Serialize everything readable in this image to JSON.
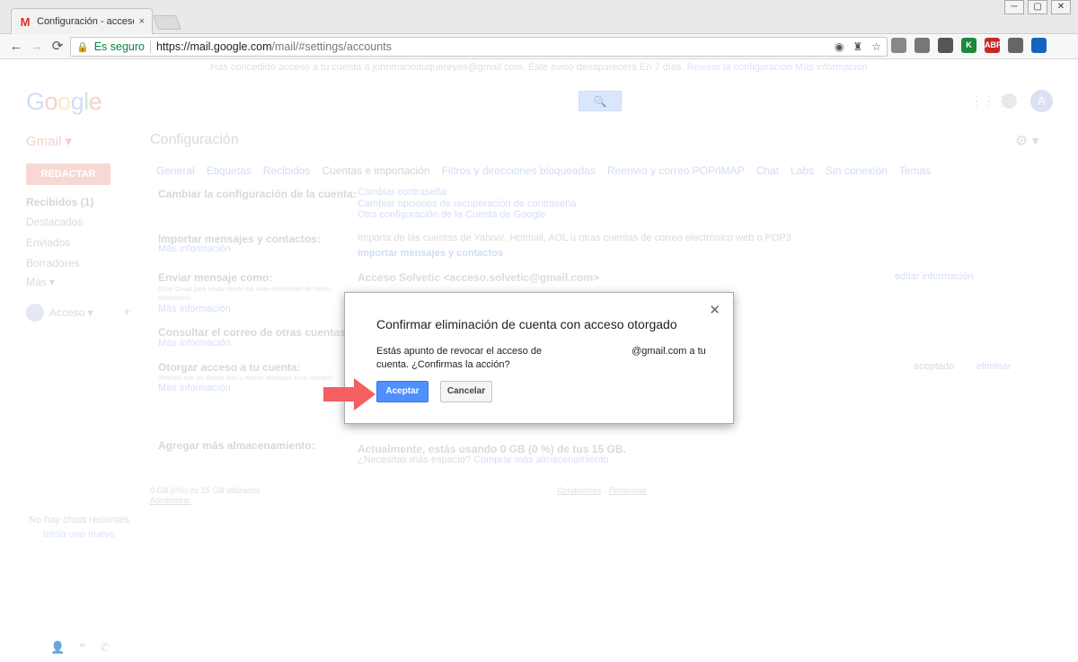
{
  "browser": {
    "tab_title": "Configuración - acceso.solvetic",
    "tab_favicon": "M",
    "tab_close": "×",
    "secure_label": "Es seguro",
    "url_host": "https://mail.google.com",
    "url_path": "/mail/#settings/accounts",
    "back": "←",
    "forward": "→",
    "reload": "⟳",
    "lock": "🔒",
    "win_min": "─",
    "win_max": "▢",
    "win_close": "✕",
    "omni_icons": [
      "◉",
      "♜",
      "☆"
    ],
    "extensions": [
      {
        "label": "",
        "color": "#888888"
      },
      {
        "label": "",
        "color": "#777777"
      },
      {
        "label": "",
        "color": "#555555"
      },
      {
        "label": "K",
        "color": "#1b8a3a"
      },
      {
        "label": "ABP",
        "color": "#c62828"
      },
      {
        "label": "",
        "color": "#666666"
      },
      {
        "label": "",
        "color": "#1565c0"
      }
    ]
  },
  "notice": {
    "text": "Has concedido acceso a tu cuenta a johnmarioduquereyes@gmail.com. Este aviso desaparecerá En 7 días.",
    "review_link": "Revisar la configuración",
    "more_link": "Más información"
  },
  "header": {
    "logo_letters": [
      "G",
      "o",
      "o",
      "g",
      "l",
      "e"
    ],
    "search_icon": "🔍",
    "apps_icon": "⋮⋮⋮",
    "avatar_letter": "A"
  },
  "gmail_label": "Gmail ▾",
  "page_title": "Configuración",
  "gear": "⚙ ▾",
  "sidebar": {
    "compose": "REDACTAR",
    "items": [
      "Recibidos (1)",
      "Destacados",
      "Enviados",
      "Borradores",
      "Más ▾"
    ],
    "account": "Acceso ▾",
    "plus": "+",
    "no_chats": "No hay chats recientes",
    "start_new": "Inicia uno nuevo",
    "bottom_icons": [
      "👤",
      "❝",
      "✆"
    ]
  },
  "settings_tabs": [
    "General",
    "Etiquetas",
    "Recibidos",
    "Cuentas e importación",
    "Filtros y direcciones bloqueadas",
    "Reenvío y correo POP/IMAP",
    "Chat",
    "Labs",
    "Sin conexión",
    "Temas"
  ],
  "sections": {
    "change": {
      "label": "Cambiar la configuración de la cuenta:",
      "links": [
        "Cambiar contraseña",
        "Cambiar opciones de recuperación de contraseña",
        "Otra configuración de la Cuenta de Google"
      ]
    },
    "import": {
      "label": "Importar mensajes y contactos:",
      "more": "Más información",
      "text": "Importa de las cuentas de Yahoo!, Hotmail, AOL u otras cuentas de correo electrónico web o POP3.",
      "action": "Importar mensajes y contactos"
    },
    "sendas": {
      "label": "Enviar mensaje como:",
      "note": "(Usar Gmail para enviar desde tus otras direcciones de correo electrónico)",
      "more": "Más información",
      "value": "Acceso Solvetic <acceso.solvetic@gmail.com>",
      "edit": "editar información"
    },
    "check": {
      "label": "Consultar el correo de otras cuentas:",
      "more": "Más información"
    },
    "grant": {
      "label": "Otorgar acceso a tu cuenta:",
      "note": "(Permitir que los demás lean y envíen mensajes en tu nombre)",
      "more": "Más información",
      "status": "aceptado",
      "delete": "eliminar"
    },
    "storage": {
      "label": "Agregar más almacenamiento:",
      "text": "Actualmente, estás usando 0 GB (0 %) de tus 15 GB.",
      "question": "¿Necesitas más espacio?",
      "buy": "Comprar más almacenamiento"
    }
  },
  "footer": {
    "usage": "0 GB (0%) de 15 GB utilizados",
    "manage": "Administrar",
    "terms": "Condiciones",
    "divider": "-",
    "privacy": "Privacidad"
  },
  "dialog": {
    "title": "Confirmar eliminación de cuenta con acceso otorgado",
    "text_part1": "Estás apunto de revocar el acceso de",
    "text_part2": "@gmail.com a tu",
    "text_line2": "cuenta. ¿Confirmas la acción?",
    "accept": "Aceptar",
    "cancel": "Cancelar",
    "close": "✕"
  },
  "colors": {
    "accept_button": "#4d90fe",
    "arrow": "#f45f5f"
  }
}
